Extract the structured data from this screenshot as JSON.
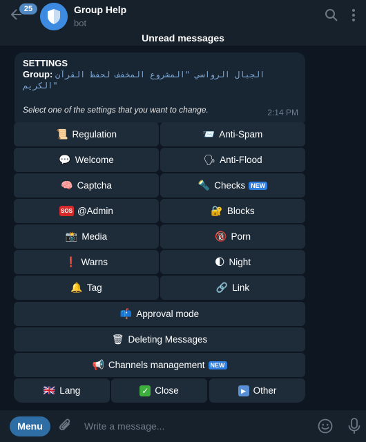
{
  "header": {
    "unread_count": "25",
    "title": "Group Help",
    "subtitle": "bot",
    "icons": [
      "back-arrow-icon",
      "shield-icon",
      "search-icon",
      "more-vertical-icon"
    ]
  },
  "divider": {
    "label": "Unread messages"
  },
  "message": {
    "title": "SETTINGS",
    "group_label": "Group:",
    "group_name": "الجبال الرواسي \"المشروع المخفف لحفظ القرآن الكريم\"",
    "hint": "Select one of the settings that you want to change.",
    "time": "2:14 PM"
  },
  "keyboard": {
    "regulation": {
      "emoji": "📜",
      "label": "Regulation"
    },
    "anti_spam": {
      "emoji": "📨",
      "label": "Anti-Spam"
    },
    "welcome": {
      "emoji": "💬",
      "label": "Welcome"
    },
    "anti_flood": {
      "emoji": "🗣",
      "label": "Anti-Flood"
    },
    "captcha": {
      "emoji": "🧠",
      "label": "Captcha"
    },
    "checks": {
      "emoji": "🔦",
      "label": "Checks",
      "badge": "NEW"
    },
    "admin": {
      "badge": "SOS",
      "label": "@Admin"
    },
    "blocks": {
      "emoji": "🔐",
      "label": "Blocks"
    },
    "media": {
      "emoji": "📸",
      "label": "Media"
    },
    "porn": {
      "emoji": "🔞",
      "label": "Porn"
    },
    "warns": {
      "emoji": "❗",
      "label": "Warns"
    },
    "night": {
      "emoji": "🌓",
      "label": "Night"
    },
    "tag": {
      "emoji": "🔔",
      "label": "Tag"
    },
    "link": {
      "emoji": "🔗",
      "label": "Link"
    },
    "approval": {
      "emoji": "📫",
      "label": "Approval mode"
    },
    "deleting": {
      "emoji": "🗑",
      "label": "Deleting Messages"
    },
    "channels": {
      "emoji": "📢",
      "label": "Channels management",
      "badge": "NEW"
    },
    "lang": {
      "emoji": "🇬🇧",
      "label": "Lang"
    },
    "close": {
      "emoji": "✓",
      "label": "Close"
    },
    "other": {
      "emoji": "▶",
      "label": "Other"
    }
  },
  "input": {
    "menu_label": "Menu",
    "placeholder": "Write a message..."
  },
  "colors": {
    "background": "#0e1621",
    "header": "#17212b",
    "bubble": "#182533",
    "button": "#1e2c3a",
    "accent": "#5288c1",
    "menu_button": "#2f6ea5"
  }
}
